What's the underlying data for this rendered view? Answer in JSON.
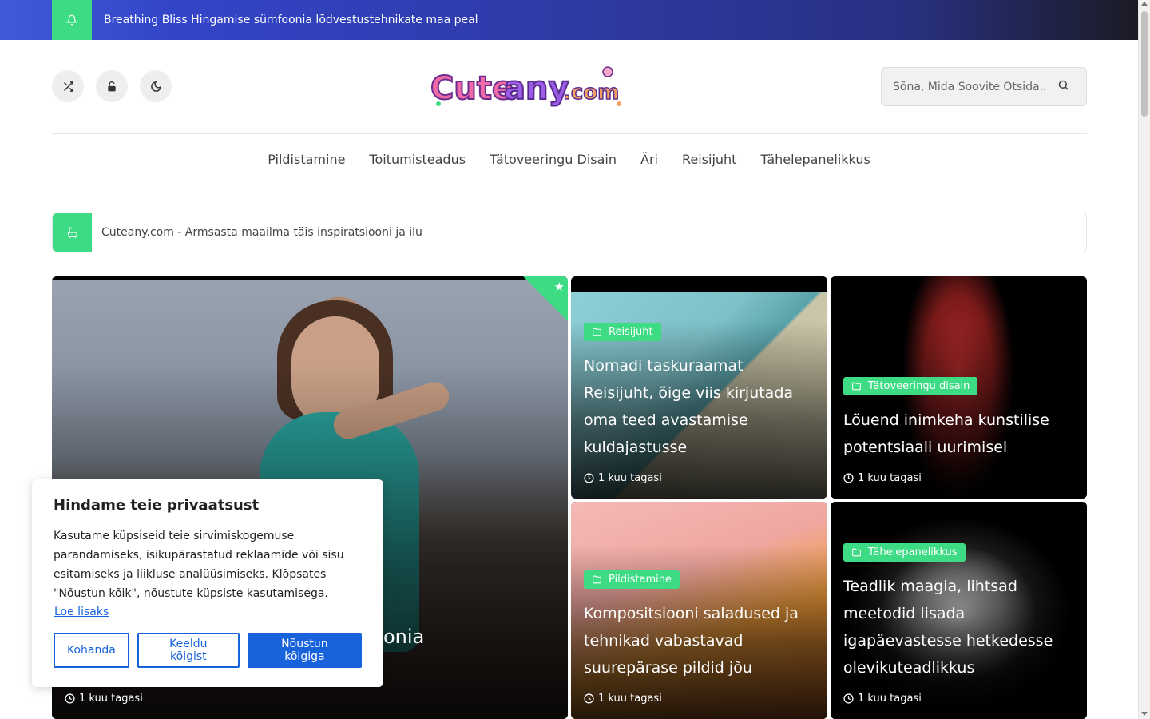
{
  "topbar": {
    "ticker": "Breathing Bliss Hingamise sümfoonia lõdvestustehnikate maa peal",
    "accent": "#3ddc84"
  },
  "header": {
    "logo_text": "Cuteany.com",
    "search_placeholder": "Sõna, Mida Soovite Otsida..",
    "icons": [
      "shuffle-icon",
      "unlock-icon",
      "moon-icon",
      "search-icon"
    ]
  },
  "nav": {
    "items": [
      "Pildistamine",
      "Toitumisteadus",
      "Tätoveeringu Disain",
      "Äri",
      "Reisijuht",
      "Tähelepanelikkus"
    ]
  },
  "tagline": {
    "text": "Cuteany.com - Armsasta maailma täis inspiratsiooni ja ilu"
  },
  "cards": {
    "main": {
      "title_fragment": "onia",
      "time": "1 kuu tagasi"
    },
    "a": {
      "category": "Reisijuht",
      "title": "Nomadi taskuraamat Reisijuht, õige viis kirjutada oma teed avastamise kuldajastusse",
      "time": "1 kuu tagasi"
    },
    "b": {
      "category": "Tätoveeringu disain",
      "title": "Lõuend inimkeha kunstilise potentsiaali uurimisel",
      "time": "1 kuu tagasi"
    },
    "c": {
      "category": "Pildistamine",
      "title": "Kompositsiooni saladused ja tehnikad vabastavad suurepärase pildid jõu",
      "time": "1 kuu tagasi"
    },
    "d": {
      "category": "Tähelepanelikkus",
      "title": "Teadlik maagia, lihtsad meetodid lisada igapäevastesse hetkedesse olevikuteadlikkus",
      "time": "1 kuu tagasi"
    }
  },
  "cookie": {
    "title": "Hindame teie privaatsust",
    "body": "Kasutame küpsiseid teie sirvimiskogemuse parandamiseks, isikupärastatud reklaamide või sisu esitamiseks ja liikluse analüüsimiseks. Klõpsates \"Nõustun kõik\", nõustute küpsiste kasutamisega.",
    "link": "Loe lisaks",
    "btn_customize": "Kohanda",
    "btn_reject": "Keeldu kõigist",
    "btn_accept": "Nõustun kõigiga",
    "accent": "#1863dc"
  }
}
